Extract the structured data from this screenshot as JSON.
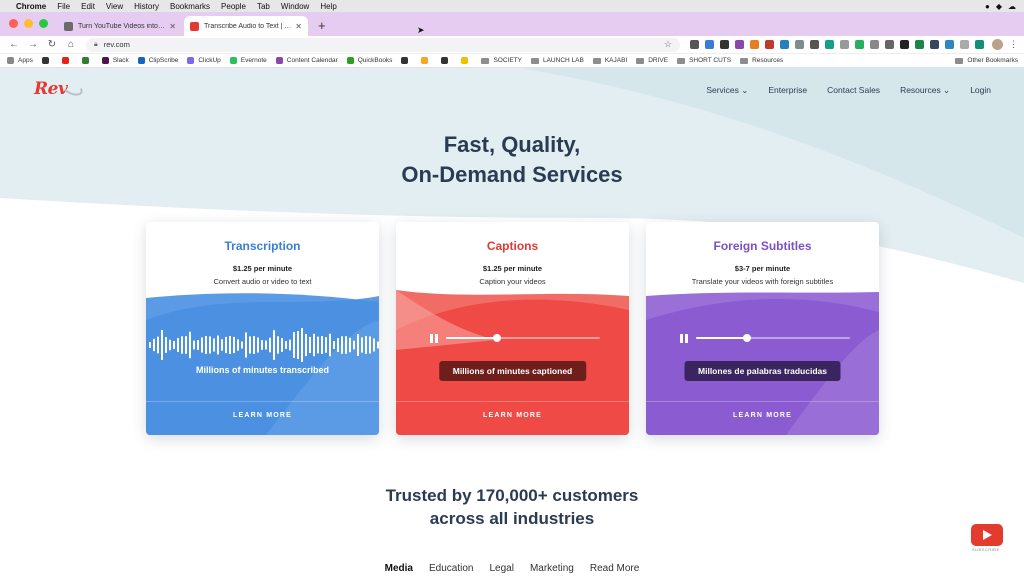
{
  "menubar": {
    "app": "Chrome",
    "items": [
      "File",
      "Edit",
      "View",
      "History",
      "Bookmarks",
      "People",
      "Tab",
      "Window",
      "Help"
    ]
  },
  "tabs": [
    {
      "title": "Turn YouTube Videos into Blog P",
      "favicon_color": "#6b6b6b",
      "active": false
    },
    {
      "title": "Transcribe Audio to Text | Transc",
      "favicon_color": "#e03a35",
      "active": true
    }
  ],
  "address": {
    "url": "rev.com"
  },
  "bookmarks": [
    {
      "label": "Apps",
      "color": "#888888"
    },
    {
      "label": "",
      "color": "#333333"
    },
    {
      "label": "",
      "color": "#e62117"
    },
    {
      "label": "",
      "color": "#2e7d32"
    },
    {
      "label": "Slack",
      "color": "#4a154b"
    },
    {
      "label": "ClipScribe",
      "color": "#1565c0"
    },
    {
      "label": "ClickUp",
      "color": "#7b68ee"
    },
    {
      "label": "Evernote",
      "color": "#2dbe60"
    },
    {
      "label": "Content Calendar",
      "color": "#8e44ad"
    },
    {
      "label": "QuickBooks",
      "color": "#2ca01c"
    },
    {
      "label": "",
      "color": "#333333"
    },
    {
      "label": "",
      "color": "#f5a623"
    },
    {
      "label": "",
      "color": "#333333"
    },
    {
      "label": "",
      "color": "#f0c000"
    },
    {
      "label": "SOCIETY",
      "folder": true
    },
    {
      "label": "LAUNCH LAB",
      "folder": true
    },
    {
      "label": "KAJABI",
      "folder": true
    },
    {
      "label": "DRIVE",
      "folder": true
    },
    {
      "label": "SHORT CUTS",
      "folder": true
    },
    {
      "label": "Resources",
      "folder": true
    }
  ],
  "other_bookmarks": "Other Bookmarks",
  "site": {
    "logo": "Rev",
    "nav": [
      "Services ⌄",
      "Enterprise",
      "Contact Sales",
      "Resources ⌄",
      "Login"
    ],
    "hero_line1": "Fast, Quality,",
    "hero_line2": "On-Demand Services"
  },
  "cards": [
    {
      "title": "Transcription",
      "price": "$1.25 per minute",
      "desc": "Convert audio or video to text",
      "stat": "Millions of minutes transcribed",
      "cta": "LEARN MORE",
      "color": "#4a8fe0",
      "title_color": "#3b7fd4"
    },
    {
      "title": "Captions",
      "price": "$1.25 per minute",
      "desc": "Caption your videos",
      "stat": "Millions of minutes captioned",
      "cta": "LEARN MORE",
      "color": "#ef4a45",
      "title_color": "#e03a35",
      "progress": 0.33
    },
    {
      "title": "Foreign Subtitles",
      "price": "$3-7 per minute",
      "desc": "Translate your videos with foreign subtitles",
      "stat": "Millones de palabras traducidas",
      "cta": "LEARN MORE",
      "color": "#8a5bd1",
      "title_color": "#7c4fc6",
      "progress": 0.33
    }
  ],
  "trusted_line1": "Trusted by 170,000+ customers",
  "trusted_line2": "across all industries",
  "industries": [
    "Media",
    "Education",
    "Legal",
    "Marketing",
    "Read More"
  ],
  "youtube_label": "SUBSCRIBE"
}
